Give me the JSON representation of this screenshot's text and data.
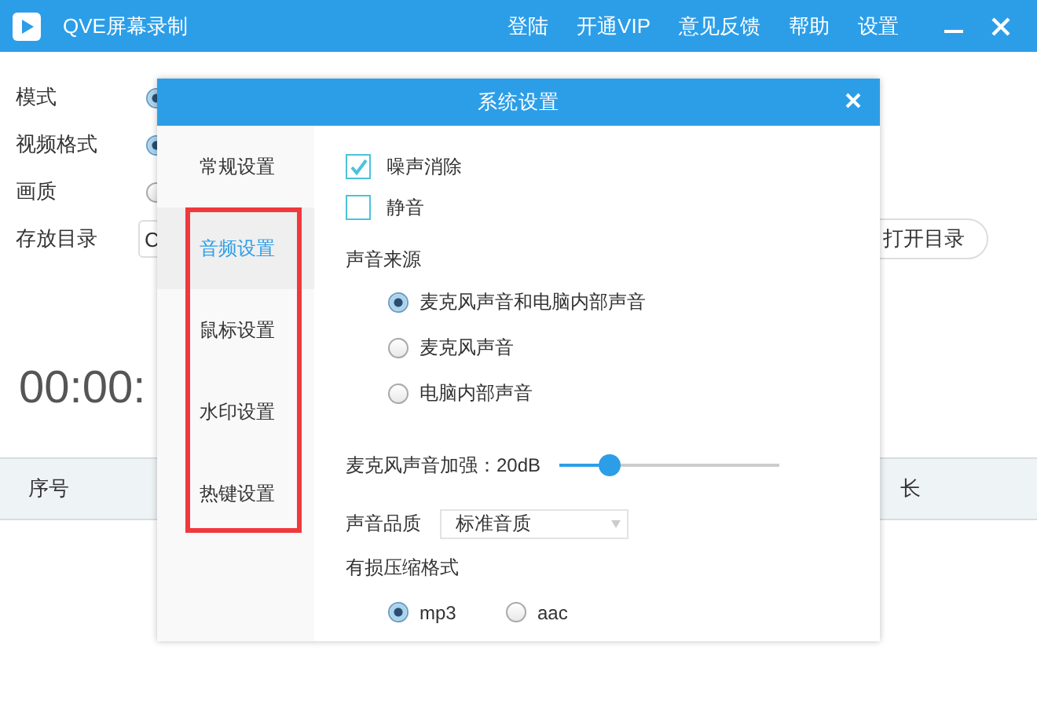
{
  "window": {
    "title": "QVE屏幕录制",
    "menu": [
      "登陆",
      "开通VIP",
      "意见反馈",
      "帮助",
      "设置"
    ]
  },
  "form": {
    "rows": [
      {
        "label": "模式",
        "kind": "radio",
        "radio_selected": true
      },
      {
        "label": "视频格式",
        "kind": "radio",
        "radio_selected": true
      },
      {
        "label": "画质",
        "kind": "radio",
        "radio_selected": false
      },
      {
        "label": "存放目录",
        "kind": "folder",
        "value": "C",
        "button": "打开目录"
      }
    ]
  },
  "timer": "00:00:",
  "table": {
    "columns": [
      "序号",
      "长"
    ]
  },
  "dialog": {
    "title": "系统设置",
    "tabs": [
      {
        "label": "常规设置",
        "selected": false
      },
      {
        "label": "音频设置",
        "selected": true
      },
      {
        "label": "鼠标设置",
        "selected": false
      },
      {
        "label": "水印设置",
        "selected": false
      },
      {
        "label": "热键设置",
        "selected": false
      }
    ],
    "checkboxes": [
      {
        "label": "噪声消除",
        "checked": true
      },
      {
        "label": "静音",
        "checked": false
      }
    ],
    "source_label": "声音来源",
    "sources": [
      {
        "label": "麦克风声音和电脑内部声音",
        "selected": true
      },
      {
        "label": "麦克风声音",
        "selected": false
      },
      {
        "label": "电脑内部声音",
        "selected": false
      }
    ],
    "boost": {
      "label": "麦克风声音加强：20dB",
      "level": 0.23
    },
    "quality": {
      "label": "声音品质",
      "value": "标准音质"
    },
    "format_label": "有损压缩格式",
    "formats": [
      {
        "label": "mp3",
        "selected": true
      },
      {
        "label": "aac",
        "selected": false
      }
    ]
  }
}
